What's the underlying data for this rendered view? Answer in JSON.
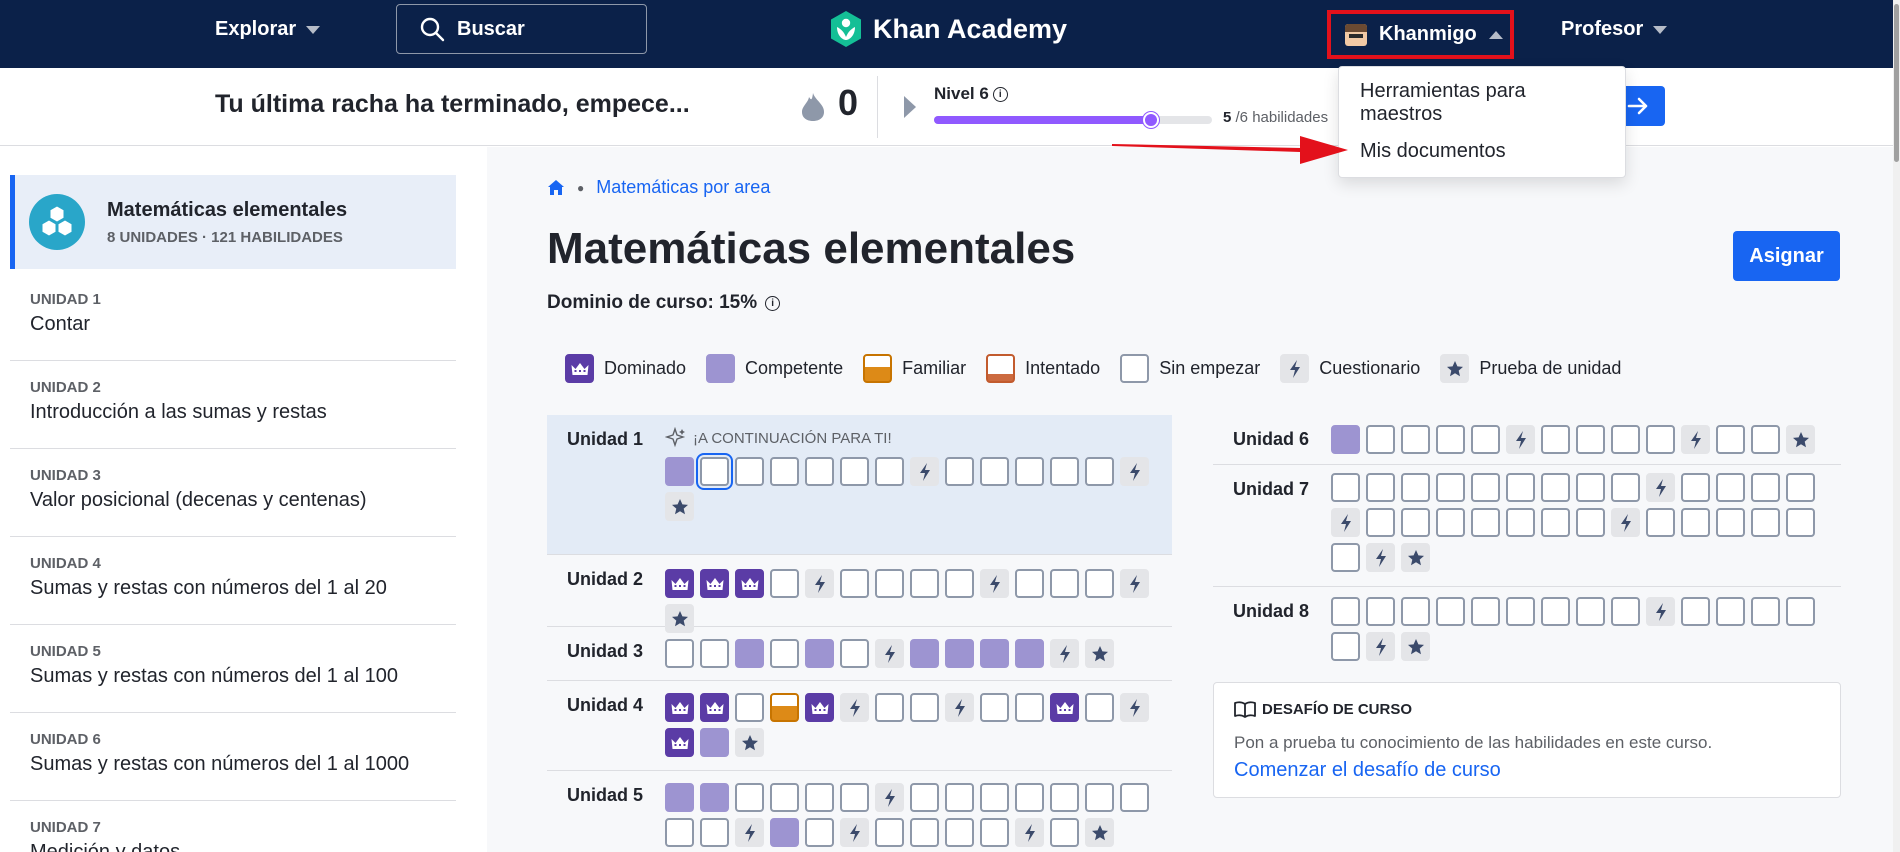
{
  "nav": {
    "explore": "Explorar",
    "search": "Buscar",
    "logo": "Khan Academy",
    "khanmigo": "Khanmigo",
    "profile": "Profesor"
  },
  "streak": {
    "message": "Tu última racha ha terminado, empece...",
    "count": "0",
    "level_label": "Nivel 6",
    "progress": 0.78,
    "skills_done": "5",
    "skills_total": " /6 habilidades"
  },
  "dropdown": {
    "items": [
      "Herramientas para maestros",
      "Mis documentos"
    ]
  },
  "sidebar": {
    "course_title": "Matemáticas elementales",
    "course_sub": "8 UNIDADES · 121 HABILIDADES",
    "units": [
      {
        "label": "UNIDAD 1",
        "title": "Contar"
      },
      {
        "label": "UNIDAD 2",
        "title": "Introducción a las sumas y restas"
      },
      {
        "label": "UNIDAD 3",
        "title": "Valor posicional (decenas y centenas)"
      },
      {
        "label": "UNIDAD 4",
        "title": "Sumas y restas con números del 1 al 20"
      },
      {
        "label": "UNIDAD 5",
        "title": "Sumas y restas con números del 1 al 100"
      },
      {
        "label": "UNIDAD 6",
        "title": "Sumas y restas con números del 1 al 1000"
      },
      {
        "label": "UNIDAD 7",
        "title": "Medición y datos"
      }
    ]
  },
  "main": {
    "breadcrumb": "Matemáticas por area",
    "title": "Matemáticas elementales",
    "assign": "Asignar",
    "mastery": "Dominio de curso: 15%",
    "legend": [
      "Dominado",
      "Competente",
      "Familiar",
      "Intentado",
      "Sin empezar",
      "Cuestionario",
      "Prueba de unidad"
    ],
    "next_tag": "¡A CONTINUACIÓN PARA TI!",
    "units": [
      {
        "name": "Unidad 1",
        "skills": "PSNNNNNQNNNNNQT"
      },
      {
        "name": "Unidad 2",
        "skills": "MMMNQNNNNQNNNQT"
      },
      {
        "name": "Unidad 3",
        "skills": "NNPNPNQPPPPQT"
      },
      {
        "name": "Unidad 4",
        "skills": "MMNFMQNNQNNMNQMPT"
      },
      {
        "name": "Unidad 5",
        "skills": "PPNNNNQNNNNNNNNNQPNQNNNNQNT"
      },
      {
        "name": "Unidad 6",
        "skills": "PNNNNQNNNNQNNT"
      },
      {
        "name": "Unidad 7",
        "skills": "NNNNNNNNNQNNNNQNNNNNNNQNNNNNNQT"
      },
      {
        "name": "Unidad 8",
        "skills": "NNNNNNNNNQNNNNNQT"
      }
    ],
    "challenge": {
      "head": "DESAFÍO DE CURSO",
      "desc": "Pon a prueba tu conocimiento de las habilidades en este curso.",
      "link": "Comenzar el desafío de curso"
    }
  },
  "colors": {
    "nav_bg": "#0b2149",
    "accent": "#1865f2",
    "mastered": "#5b3ca6",
    "proficient": "#9d94d1",
    "familiar": "#dd8a17",
    "attempted": "#cc6a3f",
    "highlight": "#e3111b"
  },
  "icons": [
    "caret-down-icon",
    "search-icon",
    "khan-logo-icon",
    "flame-icon",
    "play-icon",
    "info-icon",
    "arrow-right-icon",
    "home-icon",
    "sparkle-icon",
    "crown-icon",
    "lightning-icon",
    "star-icon",
    "book-icon",
    "course-cubes-icon"
  ]
}
